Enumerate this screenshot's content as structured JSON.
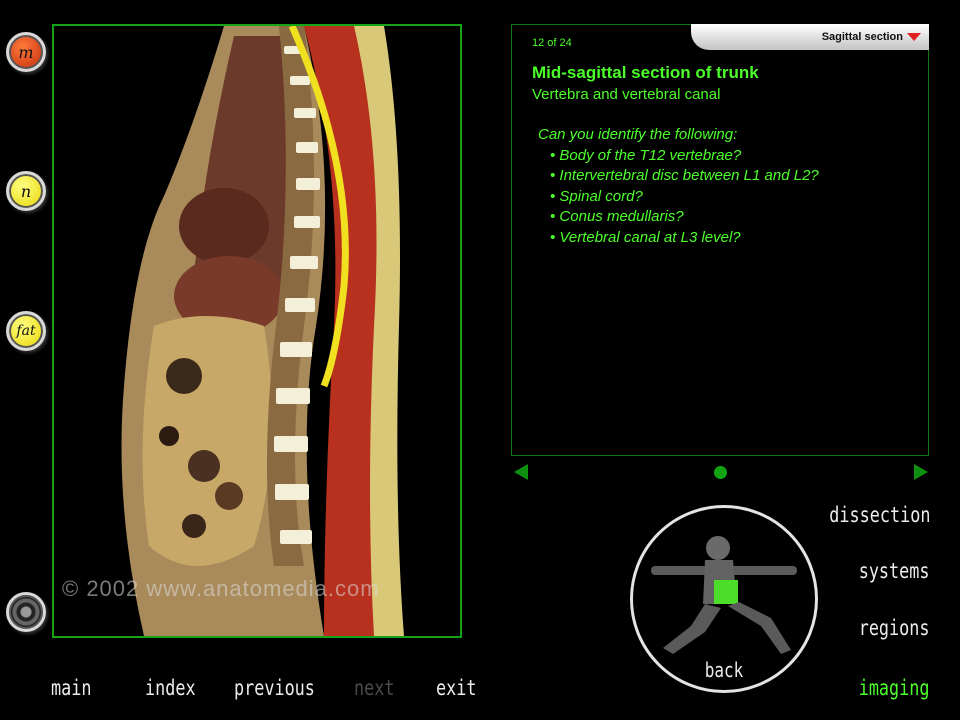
{
  "sidebar": {
    "buttons": [
      {
        "label": "m",
        "color": "#e04515"
      },
      {
        "label": "n",
        "color": "#f2e600"
      },
      {
        "label": "fat",
        "color": "#f2e600"
      }
    ]
  },
  "image": {
    "watermark": "© 2002 www.anatomedia.com"
  },
  "info": {
    "counter": "12 of 24",
    "section_dropdown": "Sagittal section",
    "title": "Mid-sagittal section of trunk",
    "subtitle": "Vertebra and vertebral canal",
    "question": "Can you identify the following:",
    "items": [
      "Body of the T12 vertebrae?",
      "Intervertebral disc between L1 and L2?",
      "Spinal cord?",
      "Conus medullaris?",
      "Vertebral canal at L3 level?"
    ]
  },
  "right_nav": {
    "dissection": "dissection",
    "systems": "systems",
    "regions": "regions",
    "imaging": "imaging",
    "back": "back"
  },
  "bottom_nav": {
    "main": "main",
    "index": "index",
    "previous": "previous",
    "next": "next",
    "exit": "exit"
  },
  "colors": {
    "accent_green": "#4cff2a",
    "border_green": "#16a316",
    "disabled": "#4a4a4a"
  }
}
